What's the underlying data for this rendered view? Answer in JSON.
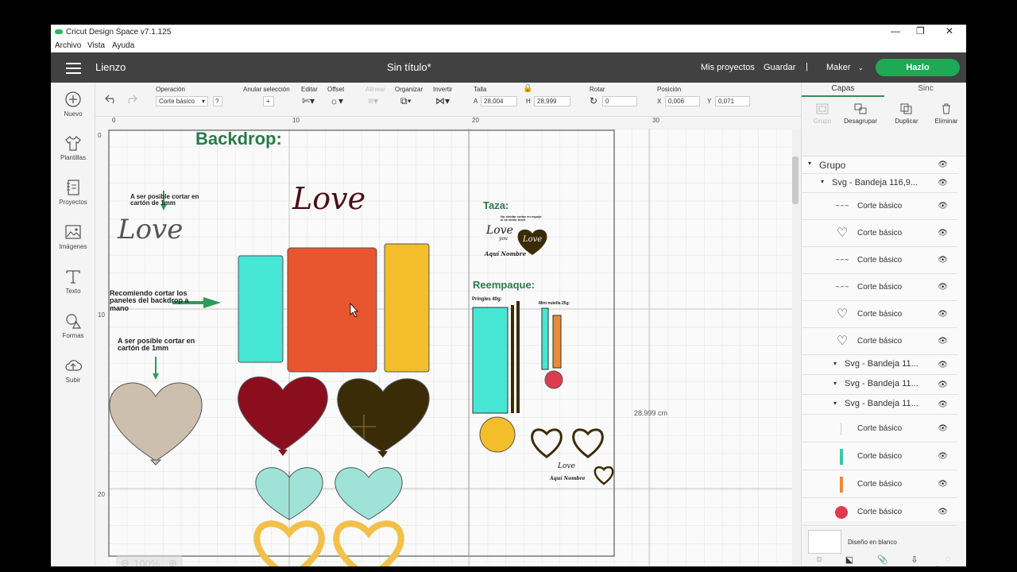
{
  "window": {
    "title": "Cricut Design Space  v7.1.125",
    "minimize": "—",
    "restore": "❐",
    "close": "✕"
  },
  "menu": [
    "Archivo",
    "Vista",
    "Ayuda"
  ],
  "header": {
    "section": "Lienzo",
    "doc_title": "Sin título*",
    "my_projects": "Mis proyectos",
    "save": "Guardar",
    "separator": "|",
    "machine": "Maker",
    "make": "Hazlo"
  },
  "left_sidebar": [
    {
      "label": "Nuevo",
      "icon": "plus-circle-icon"
    },
    {
      "label": "Plantillas",
      "icon": "shirt-icon"
    },
    {
      "label": "Proyectos",
      "icon": "notebook-icon"
    },
    {
      "label": "Imágenes",
      "icon": "image-icon"
    },
    {
      "label": "Texto",
      "icon": "text-icon"
    },
    {
      "label": "Formas",
      "icon": "shapes-icon"
    },
    {
      "label": "Subir",
      "icon": "upload-cloud-icon"
    }
  ],
  "toolbar": {
    "operation_label": "Operación",
    "operation_value": "Corte básico",
    "help": "?",
    "deselect": "Anular selección",
    "edit": "Editar",
    "offset": "Offset",
    "align": "Alinear",
    "arrange": "Organizar",
    "flip": "Invertir",
    "size_label": "Talla",
    "width_prefix": "A",
    "width_value": "28,004",
    "height_prefix": "H",
    "height_value": "28,999",
    "rotate_label": "Rotar",
    "rotate_value": "0",
    "position_label": "Posición",
    "x_prefix": "X",
    "x_value": "0,006",
    "y_prefix": "Y",
    "y_value": "0,071"
  },
  "canvas": {
    "ruler_top": [
      "0",
      "10",
      "20",
      "30"
    ],
    "ruler_left": [
      "0",
      "10",
      "20"
    ],
    "backdrop_title": "Backdrop:",
    "note_cut_1": "A ser posible cortar en cartón de 1mm",
    "note_hand": "Recomiendo cortar los paneles del backdrop a mano",
    "note_cut_2": "A ser posible cortar en cartón de 1mm",
    "love_text": "Love",
    "taza_title": "Taza:",
    "taza_note": "No olvidar cortar en espejo si es vinilo textil",
    "taza_love": "Love",
    "taza_you": "you",
    "taza_name": "Aquí Nombre",
    "reempaque_title": "Reempaque:",
    "pringles": "Pringles 40g:",
    "nutella": "Mini nutella 25g:",
    "small_love": "Love",
    "small_name": "Aquí Nombre",
    "dimension_label": "28.999 cm",
    "zoom": "100%"
  },
  "right_panel": {
    "tabs": [
      "Capas",
      "Sinc"
    ],
    "actions": [
      "Grupo",
      "Desagrupar",
      "Duplicar",
      "Eliminar"
    ],
    "layers": [
      {
        "label": "Grupo",
        "type": "group"
      },
      {
        "label": "Svg - Bandeja 116,9...",
        "type": "subgroup"
      },
      {
        "label": "Corte básico",
        "thumb": "text"
      },
      {
        "label": "Corte básico",
        "thumb": "heart"
      },
      {
        "label": "Corte básico",
        "thumb": "text"
      },
      {
        "label": "Corte básico",
        "thumb": "text"
      },
      {
        "label": "Corte básico",
        "thumb": "heart"
      },
      {
        "label": "Corte básico",
        "thumb": "heart"
      },
      {
        "label": "Svg - Bandeja 11...",
        "type": "subgroup"
      },
      {
        "label": "Svg - Bandeja 11...",
        "type": "subgroup"
      },
      {
        "label": "Svg - Bandeja 11...",
        "type": "subgroup"
      },
      {
        "label": "Corte básico",
        "thumb": "line",
        "color": "#cccccc"
      },
      {
        "label": "Corte básico",
        "thumb": "bar",
        "color": "#3fc4a8"
      },
      {
        "label": "Corte básico",
        "thumb": "bar",
        "color": "#e88b3a"
      },
      {
        "label": "Corte básico",
        "thumb": "dot",
        "color": "#e03a4e"
      }
    ],
    "blank_design": "Diseño en blanco",
    "bottom_actions": [
      "Rebanar",
      "Soldar",
      "Adjuntar",
      "Aplanar",
      "Contorno"
    ]
  },
  "colors": {
    "accent_green": "#1ea954",
    "header_bg": "#414141",
    "turquoise": "#45e6d4",
    "orange": "#e8552e",
    "yellow": "#f3be2a",
    "dark_red": "#8b0e1e",
    "dark_brown": "#3b2c08",
    "beige": "#cdbfae",
    "mint": "#9fe3d8",
    "gold": "#f2c04b"
  }
}
